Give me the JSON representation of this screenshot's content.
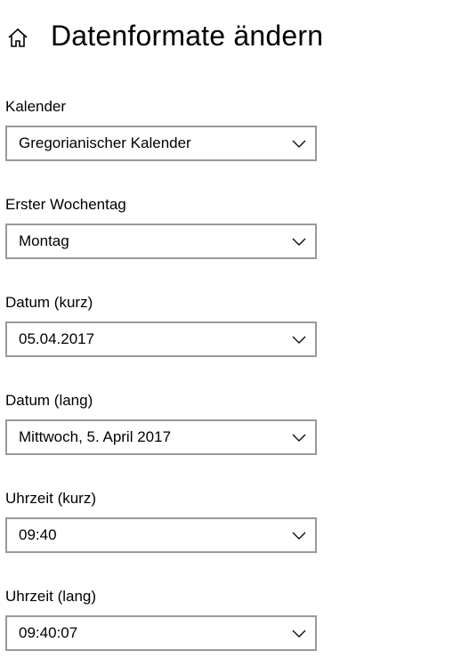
{
  "header": {
    "title": "Datenformate ändern",
    "home_icon": "home-icon"
  },
  "settings": [
    {
      "label": "Kalender",
      "value": "Gregorianischer Kalender"
    },
    {
      "label": "Erster Wochentag",
      "value": "Montag"
    },
    {
      "label": "Datum (kurz)",
      "value": "05.04.2017"
    },
    {
      "label": "Datum (lang)",
      "value": "Mittwoch, 5. April 2017"
    },
    {
      "label": "Uhrzeit (kurz)",
      "value": "09:40"
    },
    {
      "label": "Uhrzeit (lang)",
      "value": "09:40:07"
    }
  ],
  "colors": {
    "background": "#ffffff",
    "text": "#000000",
    "combo_border": "#999999"
  }
}
